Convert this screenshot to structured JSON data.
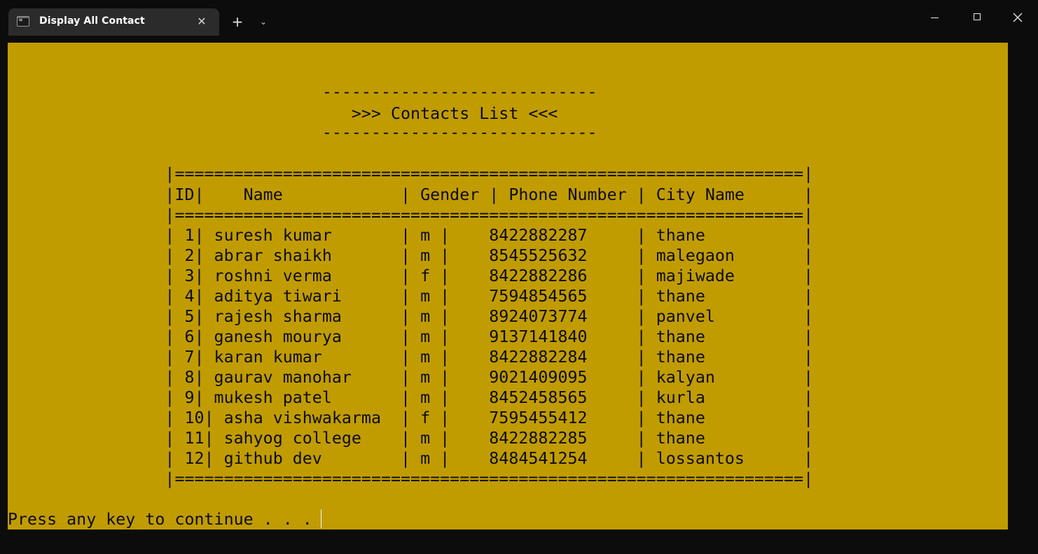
{
  "window": {
    "tab_title": "Display All Contact",
    "tab_icon": "terminal-icon",
    "close_tab_glyph": "✕",
    "new_tab_glyph": "+",
    "dropdown_glyph": "⌄"
  },
  "console": {
    "background": "#c19c00",
    "foreground": "#0c0c0c",
    "lines": [
      "",
      "",
      "                                ----------------------------",
      "                                   >>> Contacts List <<<",
      "                                ----------------------------",
      "",
      "                |================================================================|",
      "                |ID|    Name            | Gender | Phone Number | City Name      |",
      "                |================================================================|",
      "                | 1| suresh kumar       | m |    8422882287     | thane          |",
      "                | 2| abrar shaikh       | m |    8545525632     | malegaon       |",
      "                | 3| roshni verma       | f |    8422882286     | majiwade       |",
      "                | 4| aditya tiwari      | m |    7594854565     | thane          |",
      "                | 5| rajesh sharma      | m |    8924073774     | panvel         |",
      "                | 6| ganesh mourya      | m |    9137141840     | thane          |",
      "                | 7| karan kumar        | m |    8422882284     | thane          |",
      "                | 8| gaurav manohar     | m |    9021409095     | kalyan         |",
      "                | 9| mukesh patel       | m |    8452458565     | kurla          |",
      "                | 10| asha vishwakarma  | f |    7595455412     | thane          |",
      "                | 11| sahyog college    | m |    8422882285     | thane          |",
      "                | 12| github dev        | m |    8484541254     | lossantos      |",
      "                |================================================================|",
      "",
      "Press any key to continue . . ."
    ]
  }
}
